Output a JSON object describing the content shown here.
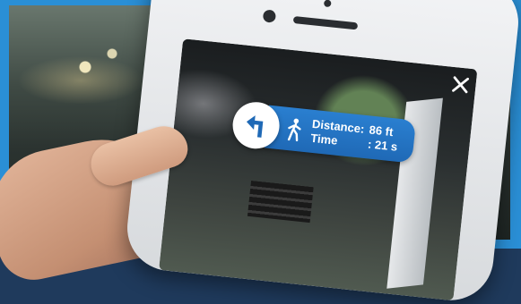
{
  "ar_overlay": {
    "distance_label": "Distance:",
    "distance_value": "86 ft",
    "time_label": "Time",
    "time_value": ": 21 s",
    "turn_icon": "turn-left-arrow-icon",
    "walk_icon": "walking-person-icon",
    "accent_color": "#1f69b6"
  },
  "controls": {
    "close_icon": "close-icon"
  }
}
